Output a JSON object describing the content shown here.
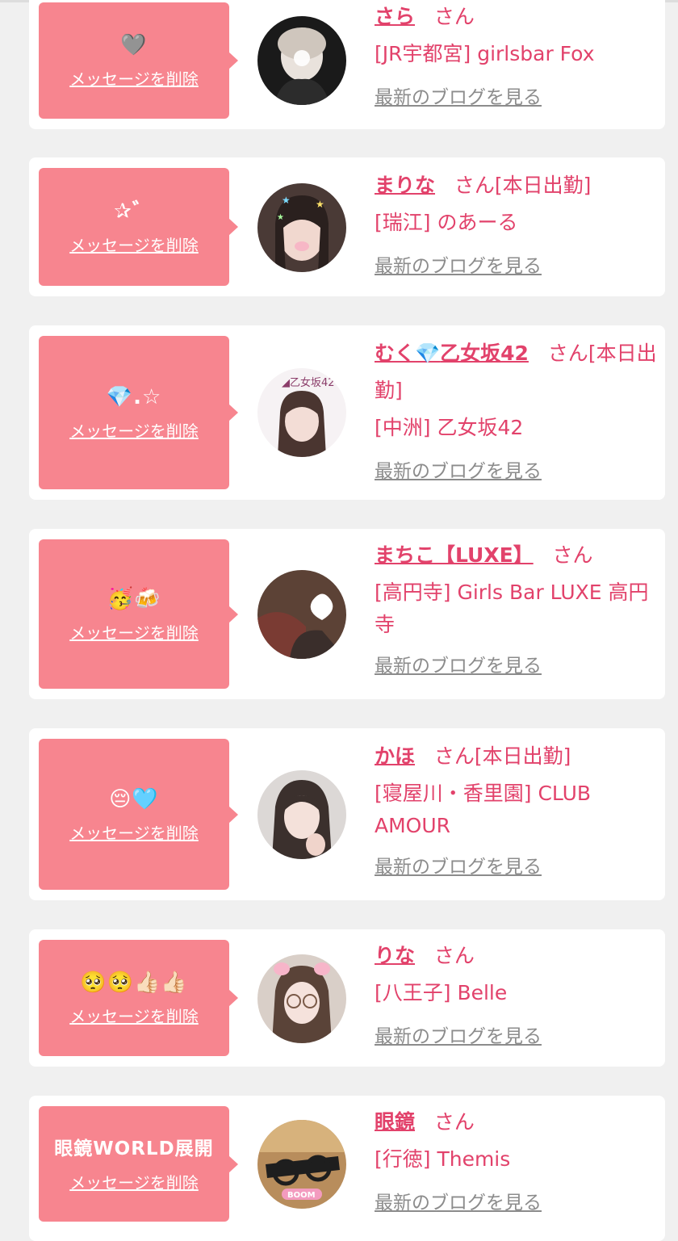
{
  "cards": [
    {
      "emoji": "🩶",
      "delete_label": "メッセージを削除",
      "name": "さら",
      "honorific": "さん",
      "status": "",
      "shop": "[JR宇都宮] girlsbar Fox",
      "blog_link": "最新のブログを見る"
    },
    {
      "emoji": "✰゛",
      "delete_label": "メッセージを削除",
      "name": "まりな",
      "honorific": "さん",
      "status": "[本日出勤]",
      "shop": "[瑞江] のあーる",
      "blog_link": "最新のブログを見る"
    },
    {
      "emoji": "💎.☆",
      "delete_label": "メッセージを削除",
      "name_prefix": "むく",
      "name_gem": "💎",
      "name_suffix": "乙女坂42",
      "honorific": "さん",
      "status": "[本日出勤]",
      "shop": "[中洲] 乙女坂42",
      "blog_link": "最新のブログを見る"
    },
    {
      "emoji": "🥳🍻",
      "delete_label": "メッセージを削除",
      "name": "まちこ【LUXE】",
      "honorific": "さん",
      "status": "",
      "shop": "[高円寺] Girls Bar LUXE 高円寺",
      "blog_link": "最新のブログを見る"
    },
    {
      "emoji": "😔🩵",
      "delete_label": "メッセージを削除",
      "name": "かほ",
      "honorific": "さん",
      "status": "[本日出勤]",
      "shop": "[寝屋川・香里園] CLUB AMOUR",
      "blog_link": "最新のブログを見る"
    },
    {
      "emoji": "🥺🥺👍🏻👍🏻",
      "delete_label": "メッセージを削除",
      "name": "りな",
      "honorific": "さん",
      "status": "",
      "shop": "[八王子] Belle",
      "blog_link": "最新のブログを見る"
    },
    {
      "emoji": "眼鏡WORLD展開",
      "delete_label": "メッセージを削除",
      "name": "眼鏡",
      "honorific": "さん",
      "status": "",
      "shop": "[行徳] Themis",
      "blog_link": "最新のブログを見る"
    }
  ],
  "colors": {
    "page_bg": "#f0f0f0",
    "card_bg": "#ffffff",
    "bubble_bg": "#f7858f",
    "accent_text": "#e2426b",
    "link_gray": "#8c8c8c"
  }
}
